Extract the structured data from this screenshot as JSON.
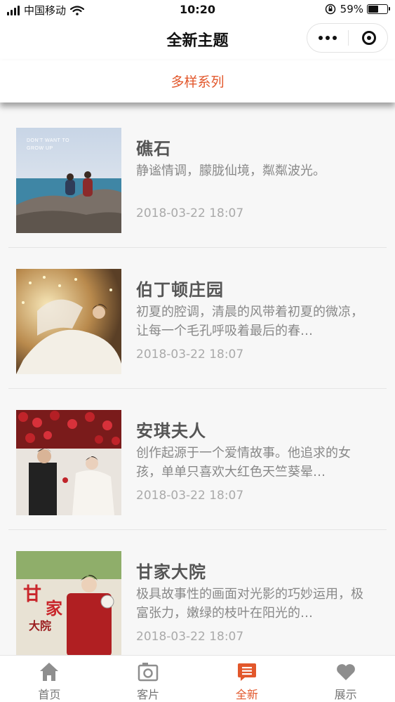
{
  "status_bar": {
    "carrier": "中国移动",
    "time": "10:20",
    "battery": "59%",
    "battery_level": 0.59
  },
  "nav": {
    "title": "全新主题"
  },
  "series_tab": {
    "label": "多样系列"
  },
  "items": [
    {
      "title": "礁石",
      "desc": "静谧情调，朦胧仙境，粼粼波光。",
      "date": "2018-03-22 18:07",
      "thumb_text": [
        "DON'T WANT TO",
        "GROW UP"
      ]
    },
    {
      "title": "伯丁顿庄园",
      "desc": "初夏的腔调，清晨的风带着初夏的微凉，让每一个毛孔呼吸着最后的春…",
      "date": "2018-03-22 18:07"
    },
    {
      "title": "安琪夫人",
      "desc": "创作起源于一个爱情故事。他追求的女孩，单单只喜欢大红色天竺葵晕…",
      "date": "2018-03-22 18:07"
    },
    {
      "title": "甘家大院",
      "desc": "极具故事性的画面对光影的巧妙运用，极富张力，嫩绿的枝叶在阳光的…",
      "date": "2018-03-22 18:07",
      "thumb_text": [
        "甘",
        "家",
        "大院"
      ]
    }
  ],
  "tab_bar": {
    "tabs": [
      {
        "label": "首页",
        "icon": "home-icon"
      },
      {
        "label": "客片",
        "icon": "camera-icon"
      },
      {
        "label": "全新",
        "icon": "message-icon",
        "active": true
      },
      {
        "label": "展示",
        "icon": "heart-icon"
      }
    ],
    "accent": "#e2572b"
  }
}
